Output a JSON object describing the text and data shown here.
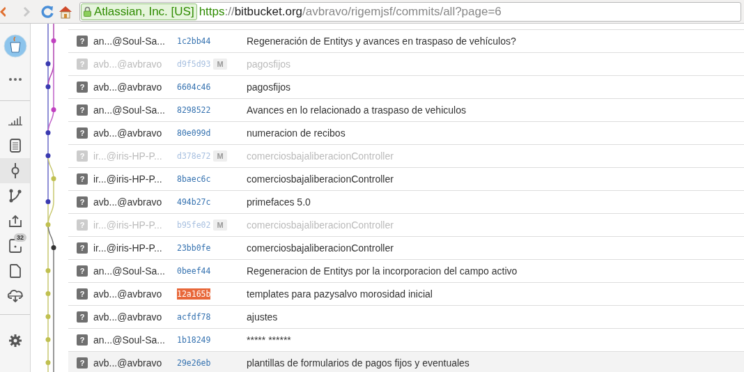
{
  "browser": {
    "ev_label": "Atlassian, Inc. [US]",
    "url_scheme": "https",
    "url_separator": "://",
    "url_host": "bitbucket.org",
    "url_path": "/avbravo/rigemjsf/commits/all?page=6"
  },
  "sidebar": {
    "top_items": [
      {
        "kind": "avatar"
      },
      {
        "kind": "more"
      }
    ],
    "items": [
      {
        "kind": "overview",
        "selected": false
      },
      {
        "kind": "source",
        "selected": false
      },
      {
        "kind": "commits",
        "selected": true
      },
      {
        "kind": "branches",
        "selected": false
      },
      {
        "kind": "upload",
        "selected": false
      },
      {
        "kind": "pullrequests",
        "selected": false,
        "badge": "32"
      },
      {
        "kind": "file",
        "selected": false
      },
      {
        "kind": "cloud",
        "selected": false
      }
    ],
    "bottom_items": [
      {
        "kind": "settings"
      }
    ]
  },
  "rows": [
    {
      "kind": "commit",
      "avatar": "?",
      "author": "an...@Soul-Sa...",
      "hash": "1c2bb44",
      "message": "Regeneración de Entitys y avances en traspaso de vehículos?",
      "color": "#c040c0",
      "highlighted": false,
      "selected": false
    },
    {
      "kind": "merge",
      "avatar": "?",
      "author": "avb...@avbravo",
      "hash": "d9f5d93",
      "badge": "M",
      "message": "pagosfijos",
      "color": "#3a3ab0",
      "highlighted": false,
      "selected": false
    },
    {
      "kind": "commit",
      "avatar": "?",
      "author": "avb...@avbravo",
      "hash": "6604c46",
      "message": "pagosfijos",
      "color": "#3a3ab0",
      "highlighted": false,
      "selected": false
    },
    {
      "kind": "commit",
      "avatar": "?",
      "author": "an...@Soul-Sa...",
      "hash": "8298522",
      "message": "Avances en lo relacionado a traspaso de vehiculos",
      "color": "#c040c0",
      "highlighted": false,
      "selected": false
    },
    {
      "kind": "commit",
      "avatar": "?",
      "author": "avb...@avbravo",
      "hash": "80e099d",
      "message": "numeracion de recibos",
      "color": "#3a3ab0",
      "highlighted": false,
      "selected": false
    },
    {
      "kind": "merge",
      "avatar": "?",
      "author": "ir...@iris-HP-P...",
      "hash": "d378e72",
      "badge": "M",
      "message": "comerciosbajaliberacionController",
      "color": "#3a3ab0",
      "highlighted": false,
      "selected": false
    },
    {
      "kind": "commit",
      "avatar": "?",
      "author": "ir...@iris-HP-P...",
      "hash": "8baec6c",
      "message": "comerciosbajaliberacionController",
      "color": "#c0c050",
      "highlighted": false,
      "selected": false
    },
    {
      "kind": "commit",
      "avatar": "?",
      "author": "avb...@avbravo",
      "hash": "494b27c",
      "message": "primefaces 5.0",
      "color": "#3a3ab0",
      "highlighted": false,
      "selected": false
    },
    {
      "kind": "merge",
      "avatar": "?",
      "author": "ir...@iris-HP-P...",
      "hash": "b95fe02",
      "badge": "M",
      "message": "comerciosbajaliberacionController",
      "color": "#c0c050",
      "highlighted": false,
      "selected": false
    },
    {
      "kind": "commit",
      "avatar": "?",
      "author": "ir...@iris-HP-P...",
      "hash": "23bb0fe",
      "message": "comerciosbajaliberacionController",
      "color": "#333333",
      "highlighted": false,
      "selected": false
    },
    {
      "kind": "commit",
      "avatar": "?",
      "author": "an...@Soul-Sa...",
      "hash": "0beef44",
      "message": "Regeneracion de Entitys por la incorporacion del campo activo",
      "color": "#c0c050",
      "highlighted": false,
      "selected": false
    },
    {
      "kind": "commit",
      "avatar": "?",
      "author": "avb...@avbravo",
      "hash": "12a165b",
      "message": "templates para pazysalvo morosidad inicial",
      "color": "#c0c050",
      "highlighted": true,
      "selected": false
    },
    {
      "kind": "commit",
      "avatar": "?",
      "author": "avb...@avbravo",
      "hash": "acfdf78",
      "message": "ajustes",
      "color": "#c0c050",
      "highlighted": false,
      "selected": false
    },
    {
      "kind": "commit",
      "avatar": "?",
      "author": "an...@Soul-Sa...",
      "hash": "1b18249",
      "message": "***** ******",
      "color": "#c0c050",
      "highlighted": false,
      "selected": false
    },
    {
      "kind": "commit",
      "avatar": "?",
      "author": "avb...@avbravo",
      "hash": "29e26eb",
      "message": "plantillas de formularios de pagos fijos y eventuales",
      "color": "#c0c050",
      "highlighted": false,
      "selected": true
    }
  ]
}
